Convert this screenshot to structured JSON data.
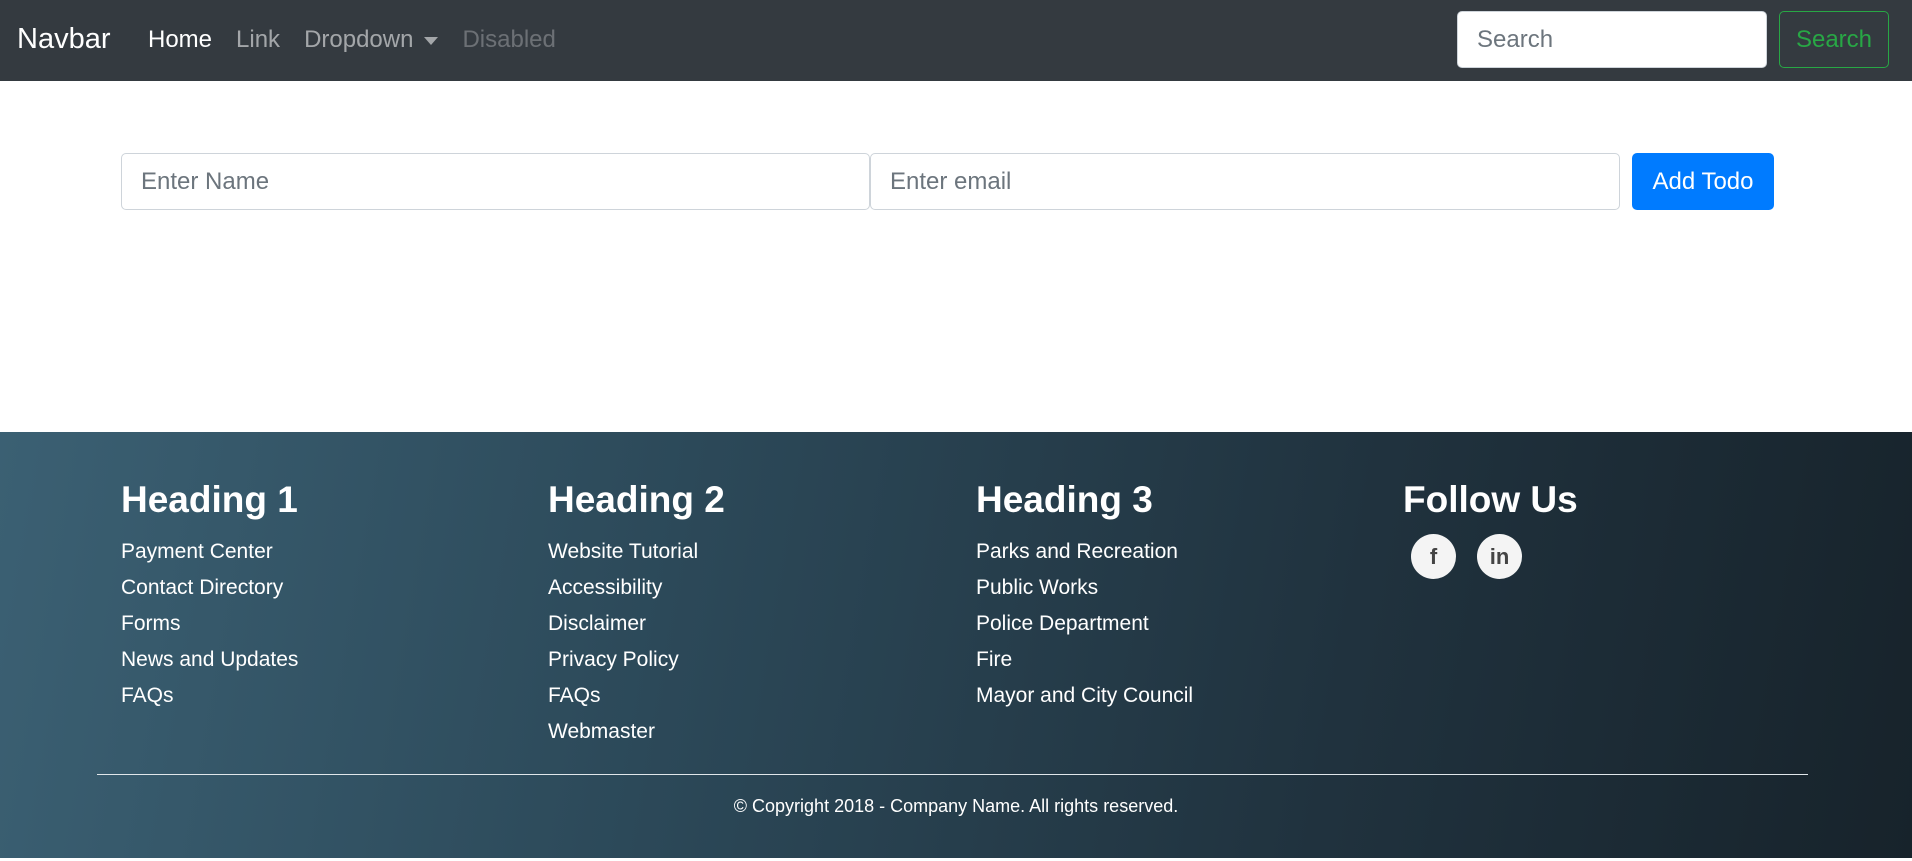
{
  "navbar": {
    "brand": "Navbar",
    "links": [
      {
        "label": "Home",
        "state": "active"
      },
      {
        "label": "Link",
        "state": "normal"
      },
      {
        "label": "Dropdown",
        "state": "normal"
      },
      {
        "label": "Disabled",
        "state": "disabled"
      }
    ],
    "search": {
      "placeholder": "Search",
      "value": ""
    },
    "search_button": "Search"
  },
  "form": {
    "name_input": {
      "placeholder": "Enter Name",
      "value": ""
    },
    "email_input": {
      "placeholder": "Enter email",
      "value": ""
    },
    "submit_label": "Add Todo",
    "submit_color": "#007bff"
  },
  "footer": {
    "columns": [
      {
        "heading": "Heading 1",
        "items": [
          "Payment Center",
          "Contact Directory",
          "Forms",
          "News and Updates",
          "FAQs"
        ]
      },
      {
        "heading": "Heading 2",
        "items": [
          "Website Tutorial",
          "Accessibility",
          "Disclaimer",
          "Privacy Policy",
          "FAQs",
          "Webmaster"
        ]
      },
      {
        "heading": "Heading 3",
        "items": [
          "Parks and Recreation",
          "Public Works",
          "Police Department",
          "Fire",
          "Mayor and City Council"
        ]
      }
    ],
    "follow": {
      "heading": "Follow Us",
      "icons": [
        {
          "name": "facebook-icon",
          "glyph": "f"
        },
        {
          "name": "linkedin-icon",
          "glyph": "in"
        }
      ]
    },
    "copyright": "© Copyright 2018 - Company Name. All rights reserved."
  }
}
